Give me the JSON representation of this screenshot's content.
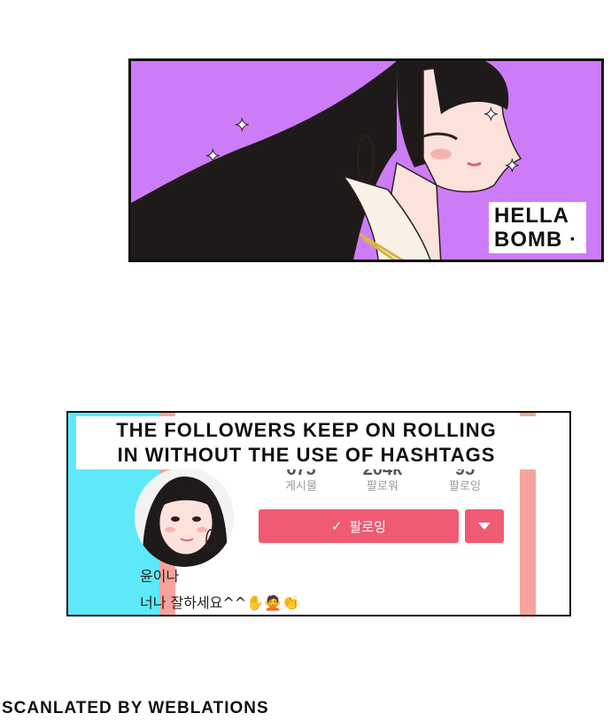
{
  "panel1": {
    "background": "#cd7cf7",
    "caption_line1": "HELLA",
    "caption_line2": "BOMB ·"
  },
  "panel2": {
    "caption_line1": "THE FOLLOWERS KEEP ON ROLLING",
    "caption_line2": "IN WITHOUT THE USE OF HASHTAGS",
    "stats": [
      {
        "value": "675",
        "label": "게시물"
      },
      {
        "value": "204k",
        "label": "팔로워"
      },
      {
        "value": "95",
        "label": "팔로잉"
      }
    ],
    "follow_label": "팔로잉",
    "username": "윤이나",
    "bio": "너나 잘하세요^^✋🙅👏",
    "accent": "#ee5b72"
  },
  "credit": "SCANLATED BY WEBLATIONS"
}
